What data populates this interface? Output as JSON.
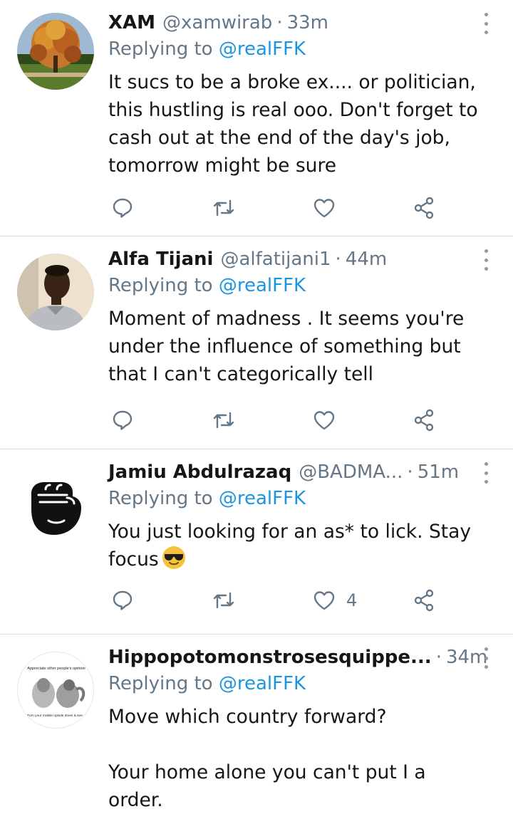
{
  "replying_label": "Replying to",
  "tweets": [
    {
      "name": "XAM",
      "handle": "@xamwirab",
      "time": "33m",
      "mention": "@realFFK",
      "text": "It sucs to be a broke ex.... or politician,\nthis hustling is real ooo. Don't forget to\ncash out at the end of the day's job,\ntomorrow might be sure",
      "like_count": "",
      "avatar": "autumn-tree-photo"
    },
    {
      "name": "Alfa Tijani",
      "handle": "@alfatijani1",
      "time": "44m",
      "mention": "@realFFK",
      "text": "Moment of madness . It seems you're\nunder the influence of something but\nthat I can't categorically tell",
      "like_count": "",
      "avatar": "man-portrait-photo"
    },
    {
      "name": "Jamiu Abdulrazaq",
      "handle": "@BADMA...",
      "time": "51m",
      "mention": "@realFFK",
      "text": "You just looking for an as* to lick. Stay\nfocus",
      "emoji": "sunglasses-face",
      "like_count": "4",
      "avatar": "raised-fist-logo"
    },
    {
      "name": "Hippopotomonstrosesquippe...",
      "handle": "",
      "time": "34m",
      "mention": "@realFFK",
      "text": "Move which country forward?\n\nYour home alone you can't put I a order.",
      "like_count": "",
      "avatar": "meme-image",
      "avatar_caption_top": "Appreciate other people's opinion",
      "avatar_caption_bottom": "Turn your mobile upside down & see..."
    }
  ],
  "colors": {
    "link": "#1b95e0",
    "secondary": "#657786",
    "divider": "#d9dde1",
    "icon": "#657786"
  }
}
